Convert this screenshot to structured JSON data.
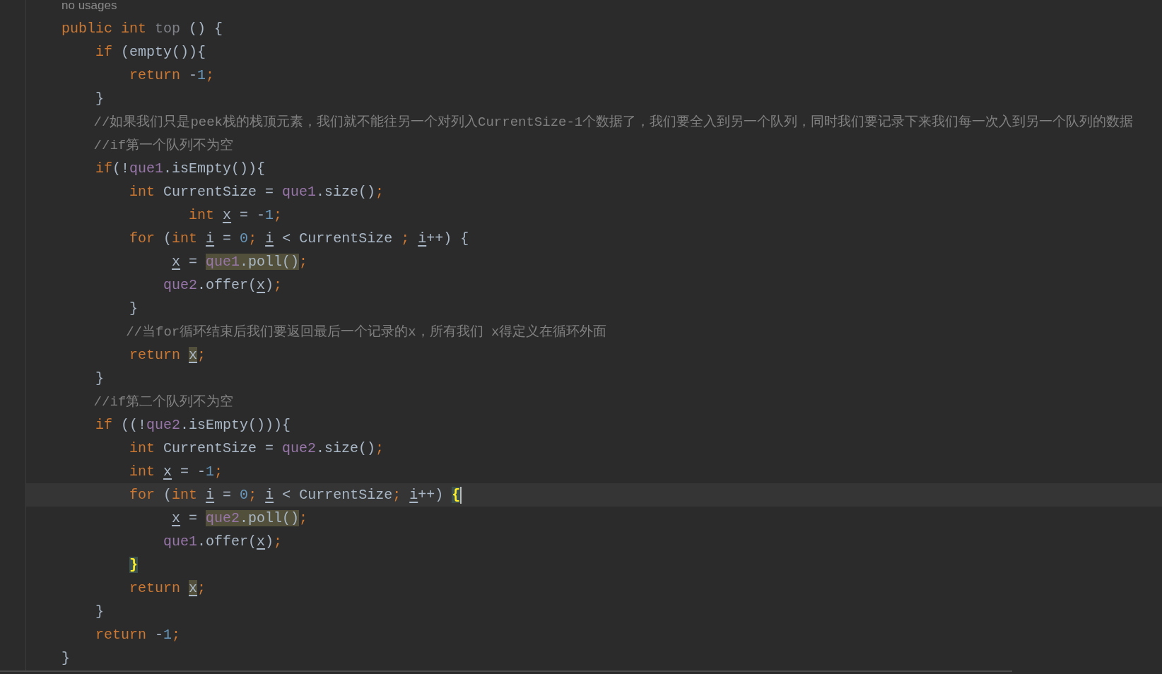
{
  "editor": {
    "lines": [
      {
        "current": false,
        "tokens": [
          {
            "kind": "hint",
            "text": "no usages"
          }
        ]
      },
      {
        "current": false,
        "tokens": [
          {
            "kind": "kw",
            "text": "public int "
          },
          {
            "kind": "dim",
            "text": "top"
          },
          {
            "kind": "pl",
            "text": " () {"
          }
        ]
      },
      {
        "current": false,
        "tokens": [
          {
            "kind": "kw",
            "text": "    if "
          },
          {
            "kind": "pl",
            "text": "(empty()){"
          }
        ]
      },
      {
        "current": false,
        "tokens": [
          {
            "kind": "kw",
            "text": "        return "
          },
          {
            "kind": "pl",
            "text": "-"
          },
          {
            "kind": "num",
            "text": "1"
          },
          {
            "kind": "kw",
            "text": ";"
          }
        ]
      },
      {
        "current": false,
        "tokens": [
          {
            "kind": "pl",
            "text": "    }"
          }
        ]
      },
      {
        "current": false,
        "tokens": [
          {
            "kind": "cmt",
            "text": "    //如果我们只是peek栈的栈顶元素，我们就不能往另一个对列入CurrentSize-1个数据了，我们要全入到另一个队列，同时我们要记录下来我们每一次入到另一个队列的数据"
          }
        ]
      },
      {
        "current": false,
        "tokens": [
          {
            "kind": "cmt",
            "text": "    //if第一个队列不为空"
          }
        ]
      },
      {
        "current": false,
        "tokens": [
          {
            "kind": "kw",
            "text": "    if"
          },
          {
            "kind": "pl",
            "text": "(!"
          },
          {
            "kind": "fld",
            "text": "que1"
          },
          {
            "kind": "pl",
            "text": ".isEmpty()){"
          }
        ]
      },
      {
        "current": false,
        "tokens": [
          {
            "kind": "kw",
            "text": "        int "
          },
          {
            "kind": "pl",
            "text": "CurrentSize = "
          },
          {
            "kind": "fld",
            "text": "que1"
          },
          {
            "kind": "pl",
            "text": ".size()"
          },
          {
            "kind": "kw",
            "text": ";"
          }
        ]
      },
      {
        "current": false,
        "tokens": [
          {
            "kind": "kw",
            "text": "               int "
          },
          {
            "kind": "var",
            "text": "x"
          },
          {
            "kind": "pl",
            "text": " = -"
          },
          {
            "kind": "num",
            "text": "1"
          },
          {
            "kind": "kw",
            "text": ";"
          }
        ]
      },
      {
        "current": false,
        "tokens": [
          {
            "kind": "kw",
            "text": "        for "
          },
          {
            "kind": "pl",
            "text": "("
          },
          {
            "kind": "kw",
            "text": "int "
          },
          {
            "kind": "var",
            "text": "i"
          },
          {
            "kind": "pl",
            "text": " = "
          },
          {
            "kind": "num",
            "text": "0"
          },
          {
            "kind": "kw",
            "text": "; "
          },
          {
            "kind": "var",
            "text": "i"
          },
          {
            "kind": "pl",
            "text": " < CurrentSize "
          },
          {
            "kind": "kw",
            "text": "; "
          },
          {
            "kind": "var",
            "text": "i"
          },
          {
            "kind": "pl",
            "text": "++) {"
          }
        ]
      },
      {
        "current": false,
        "tokens": [
          {
            "kind": "var",
            "text": "             x"
          },
          {
            "kind": "pl",
            "text": " = "
          },
          {
            "kind": "usage",
            "parts": [
              {
                "kind": "fld",
                "text": "que1"
              },
              {
                "kind": "pl",
                "text": ".poll()"
              }
            ]
          },
          {
            "kind": "kw",
            "text": ";"
          }
        ]
      },
      {
        "current": false,
        "tokens": [
          {
            "kind": "fld",
            "text": "            que2"
          },
          {
            "kind": "pl",
            "text": ".offer("
          },
          {
            "kind": "var",
            "text": "x"
          },
          {
            "kind": "pl",
            "text": ")"
          },
          {
            "kind": "kw",
            "text": ";"
          }
        ]
      },
      {
        "current": false,
        "tokens": [
          {
            "kind": "pl",
            "text": "        }"
          }
        ]
      },
      {
        "current": false,
        "tokens": [
          {
            "kind": "cmt",
            "text": "        //当for循环结束后我们要返回最后一个记录的x，所有我们 x得定义在循环外面"
          }
        ]
      },
      {
        "current": false,
        "tokens": [
          {
            "kind": "kw",
            "text": "        return "
          },
          {
            "kind": "usage",
            "parts": [
              {
                "kind": "var",
                "text": "x"
              }
            ]
          },
          {
            "kind": "kw",
            "text": ";"
          }
        ]
      },
      {
        "current": false,
        "tokens": [
          {
            "kind": "pl",
            "text": "    }"
          }
        ]
      },
      {
        "current": false,
        "tokens": [
          {
            "kind": "cmt",
            "text": "    //if第二个队列不为空"
          }
        ]
      },
      {
        "current": false,
        "tokens": [
          {
            "kind": "kw",
            "text": "    if "
          },
          {
            "kind": "pl",
            "text": "((!"
          },
          {
            "kind": "fld",
            "text": "que2"
          },
          {
            "kind": "pl",
            "text": ".isEmpty())){"
          }
        ]
      },
      {
        "current": false,
        "tokens": [
          {
            "kind": "kw",
            "text": "        int "
          },
          {
            "kind": "pl",
            "text": "CurrentSize = "
          },
          {
            "kind": "fld",
            "text": "que2"
          },
          {
            "kind": "pl",
            "text": ".size()"
          },
          {
            "kind": "kw",
            "text": ";"
          }
        ]
      },
      {
        "current": false,
        "tokens": [
          {
            "kind": "kw",
            "text": "        int "
          },
          {
            "kind": "var",
            "text": "x"
          },
          {
            "kind": "pl",
            "text": " = -"
          },
          {
            "kind": "num",
            "text": "1"
          },
          {
            "kind": "kw",
            "text": ";"
          }
        ]
      },
      {
        "current": true,
        "tokens": [
          {
            "kind": "kw",
            "text": "        for "
          },
          {
            "kind": "pl",
            "text": "("
          },
          {
            "kind": "kw",
            "text": "int "
          },
          {
            "kind": "var",
            "text": "i"
          },
          {
            "kind": "pl",
            "text": " = "
          },
          {
            "kind": "num",
            "text": "0"
          },
          {
            "kind": "kw",
            "text": "; "
          },
          {
            "kind": "var",
            "text": "i"
          },
          {
            "kind": "pl",
            "text": " < CurrentSize"
          },
          {
            "kind": "kw",
            "text": "; "
          },
          {
            "kind": "var",
            "text": "i"
          },
          {
            "kind": "pl",
            "text": "++) "
          },
          {
            "kind": "brace",
            "text": "{"
          }
        ]
      },
      {
        "current": false,
        "tokens": [
          {
            "kind": "var",
            "text": "             x"
          },
          {
            "kind": "pl",
            "text": " = "
          },
          {
            "kind": "usage",
            "parts": [
              {
                "kind": "fld",
                "text": "que2"
              },
              {
                "kind": "pl",
                "text": ".poll()"
              }
            ]
          },
          {
            "kind": "kw",
            "text": ";"
          }
        ]
      },
      {
        "current": false,
        "tokens": [
          {
            "kind": "fld",
            "text": "            que1"
          },
          {
            "kind": "pl",
            "text": ".offer("
          },
          {
            "kind": "var",
            "text": "x"
          },
          {
            "kind": "pl",
            "text": ")"
          },
          {
            "kind": "kw",
            "text": ";"
          }
        ]
      },
      {
        "current": false,
        "tokens": [
          {
            "kind": "brace",
            "text": "        }"
          }
        ]
      },
      {
        "current": false,
        "tokens": [
          {
            "kind": "kw",
            "text": "        return "
          },
          {
            "kind": "usage",
            "parts": [
              {
                "kind": "var",
                "text": "x"
              }
            ]
          },
          {
            "kind": "kw",
            "text": ";"
          }
        ]
      },
      {
        "current": false,
        "tokens": [
          {
            "kind": "pl",
            "text": "    }"
          }
        ]
      },
      {
        "current": false,
        "tokens": [
          {
            "kind": "kw",
            "text": "    return "
          },
          {
            "kind": "pl",
            "text": "-"
          },
          {
            "kind": "num",
            "text": "1"
          },
          {
            "kind": "kw",
            "text": ";"
          }
        ]
      },
      {
        "current": false,
        "tokens": [
          {
            "kind": "pl",
            "text": "}"
          }
        ]
      }
    ]
  }
}
